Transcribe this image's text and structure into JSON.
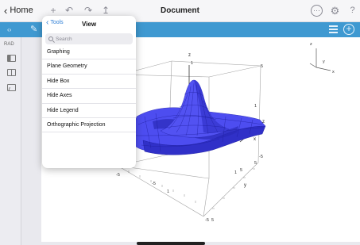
{
  "nav": {
    "back_label": "Home",
    "title": "Document"
  },
  "sidebar": {
    "mode_label": "RAD"
  },
  "popover": {
    "back_label": "Tools",
    "title": "View",
    "search_placeholder": "Search",
    "items": [
      {
        "label": "Graphing"
      },
      {
        "label": "Plane Geometry"
      },
      {
        "label": "Hide Box"
      },
      {
        "label": "Hide Axes"
      },
      {
        "label": "Hide Legend"
      },
      {
        "label": "Orthographic Projection"
      }
    ]
  },
  "plot": {
    "axis_labels": {
      "x": "x",
      "y": "y",
      "z": "z"
    },
    "tick_labels": [
      "5",
      "1",
      "1",
      "-5",
      "-5",
      "1",
      "5",
      "-5",
      "5",
      "1",
      "-5",
      "5"
    ],
    "surface_color": "#3d3de0",
    "legend_labels": {
      "x": "x",
      "y": "y",
      "z": "z"
    }
  },
  "colors": {
    "toolbar": "#3f99d1",
    "link": "#2f7fd6"
  },
  "icons": [
    "chevron-left-icon",
    "undo-icon",
    "redo-icon",
    "share-icon",
    "more-icon",
    "settings-icon",
    "help-icon",
    "menu-icon",
    "add-icon",
    "pen-icon",
    "search-icon"
  ]
}
